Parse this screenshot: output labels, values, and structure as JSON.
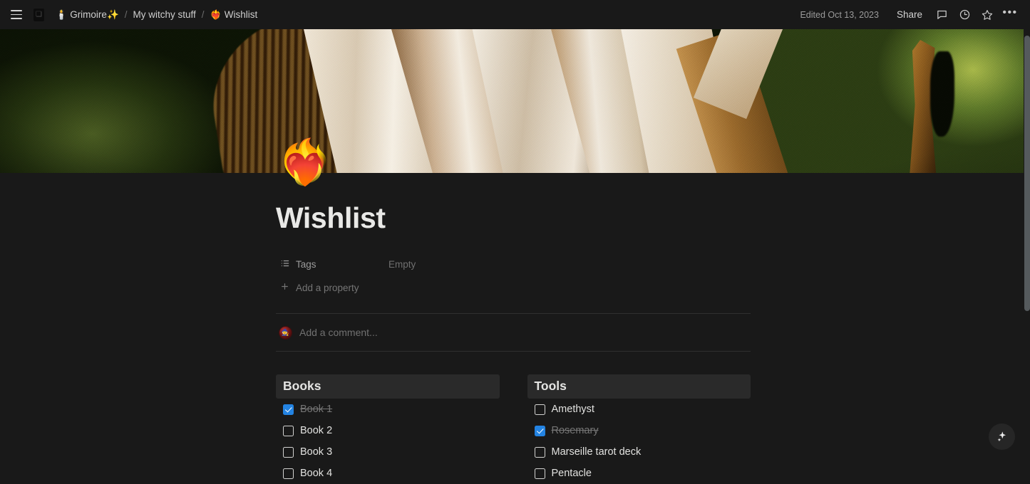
{
  "topbar": {
    "menu_icon": "hamburger-icon",
    "doc_icon": "page-icon",
    "breadcrumbs": [
      {
        "emoji": "🕯️",
        "label": "Grimoire✨",
        "icon_name": "candle-icon"
      },
      {
        "emoji": "",
        "label": "My witchy stuff",
        "icon_name": ""
      },
      {
        "emoji": "❤️‍🔥",
        "label": "Wishlist",
        "icon_name": "heart-on-fire-icon"
      }
    ],
    "separator": "/",
    "edited_label": "Edited Oct 13, 2023",
    "share_label": "Share",
    "icons": [
      "comment-icon",
      "history-clock-icon",
      "star-icon",
      "more-options-icon"
    ],
    "more_label": "•••"
  },
  "page": {
    "emoji": "❤️‍🔥",
    "emoji_name": "heart-on-fire-icon",
    "title": "Wishlist",
    "properties": [
      {
        "icon_name": "multi-select-icon",
        "name": "Tags",
        "value": "Empty"
      }
    ],
    "add_property_label": "Add a property",
    "add_property_icon": "plus-icon",
    "comment_placeholder": "Add a comment...",
    "avatar_name": "user-avatar"
  },
  "columns": [
    {
      "header": "Books",
      "items": [
        {
          "label": "Book 1",
          "checked": true
        },
        {
          "label": "Book 2",
          "checked": false
        },
        {
          "label": "Book 3",
          "checked": false
        },
        {
          "label": "Book 4",
          "checked": false
        }
      ]
    },
    {
      "header": "Tools",
      "items": [
        {
          "label": "Amethyst",
          "checked": false
        },
        {
          "label": "Rosemary",
          "checked": true
        },
        {
          "label": "Marseille tarot deck",
          "checked": false
        },
        {
          "label": "Pentacle",
          "checked": false
        }
      ]
    }
  ],
  "floating": {
    "ai_button_name": "ai-sparkle-button",
    "ai_glyph": "✦"
  },
  "colors": {
    "background": "#191919",
    "callout_bg": "#2a2a2a",
    "checkbox_accent": "#2383e2",
    "text_primary": "#e9e9e7",
    "text_muted": "#9b9b9b",
    "divider": "#2f2f2f"
  }
}
